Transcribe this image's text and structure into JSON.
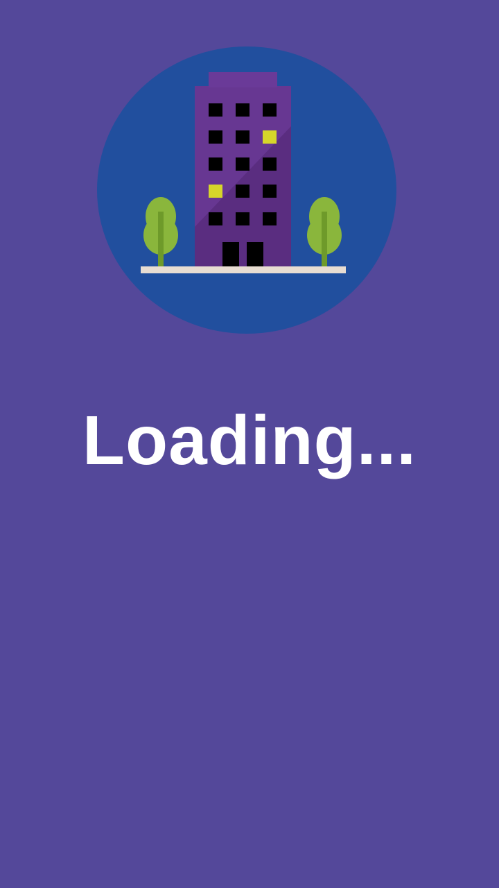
{
  "splash": {
    "logo_icon": "building-icon",
    "loading_text": "Loading..."
  },
  "colors": {
    "background": "#54489a",
    "logo_circle": "#214f9e",
    "building": "#5a2d80",
    "building_top": "#6a3a98",
    "window_dark": "#000000",
    "window_lit": "#d6d62a",
    "tree": "#8ab63c",
    "ground": "#e8ddd2",
    "text": "#ffffff"
  }
}
